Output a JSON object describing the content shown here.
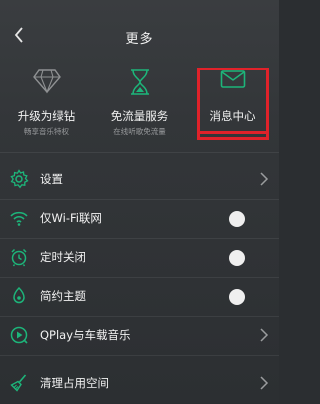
{
  "header": {
    "title": "更多"
  },
  "features": [
    {
      "label": "升级为绿钻",
      "sub": "畅享音乐特权"
    },
    {
      "label": "免流量服务",
      "sub": "在线听歌免流量"
    },
    {
      "label": "消息中心",
      "sub": ""
    }
  ],
  "list": [
    {
      "label": "设置"
    },
    {
      "label": "仅Wi-Fi联网"
    },
    {
      "label": "定时关闭"
    },
    {
      "label": "简约主题"
    },
    {
      "label": "QPlay与车载音乐"
    },
    {
      "label": "清理占用空间"
    }
  ],
  "colors": {
    "accent": "#1db57a",
    "highlight": "#e0222a",
    "background": "#2b2e31"
  }
}
